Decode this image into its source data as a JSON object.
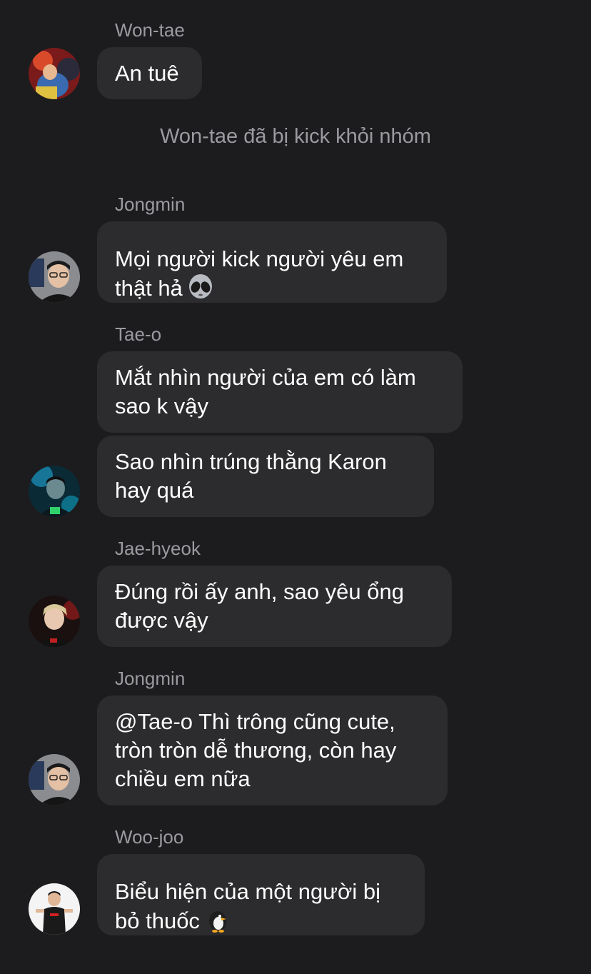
{
  "messages": [
    {
      "sender": "Won-tae",
      "text": "An tuê"
    },
    {
      "system": "Won-tae đã bị kick khỏi nhóm"
    },
    {
      "sender": "Jongmin",
      "text": "Mọi người kick người yêu em\nthật hả",
      "emoji": "alien-emoji"
    },
    {
      "sender": "Tae-o",
      "text1": "Mắt nhìn người của em có làm\nsao k vậy",
      "text2": "Sao nhìn trúng thằng Karon\nhay quá"
    },
    {
      "sender": "Jae-hyeok",
      "text": "Đúng rồi ấy anh, sao yêu ổng\nđược vậy"
    },
    {
      "sender": "Jongmin",
      "text": "@Tae-o Thì trông cũng cute,\ntròn tròn dễ thương, còn hay\nchiều em nữa"
    },
    {
      "sender": "Woo-joo",
      "text": "Biểu hiện của một người bị\nbỏ thuốc",
      "emoji": "penguin-emoji"
    }
  ],
  "colors": {
    "background": "#1c1c1e",
    "bubble": "#2c2c2e",
    "sender_text": "#9a9aa0",
    "message_text": "#ffffff"
  }
}
